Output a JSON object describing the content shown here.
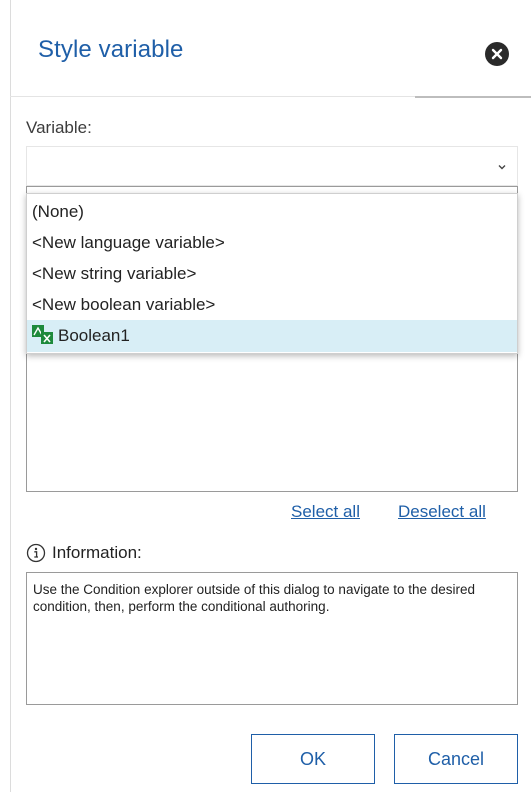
{
  "dialog": {
    "title": "Style variable"
  },
  "variable": {
    "label": "Variable:",
    "selected_value": ""
  },
  "dropdown": {
    "options": [
      {
        "label": "(None)"
      },
      {
        "label": "<New language variable>"
      },
      {
        "label": "<New string variable>"
      },
      {
        "label": "<New boolean variable>"
      },
      {
        "label": "Boolean1",
        "icon": "boolean-variable-icon",
        "highlighted": true
      }
    ]
  },
  "links": {
    "select_all": "Select all",
    "deselect_all": "Deselect all"
  },
  "information": {
    "label": "Information:",
    "text": "Use the Condition explorer outside of this dialog to navigate to the desired condition, then, perform the conditional authoring."
  },
  "buttons": {
    "ok": "OK",
    "cancel": "Cancel"
  },
  "colors": {
    "accent": "#1f5fa8",
    "highlight": "#d8eef6",
    "icon_green": "#1e8a3c"
  }
}
